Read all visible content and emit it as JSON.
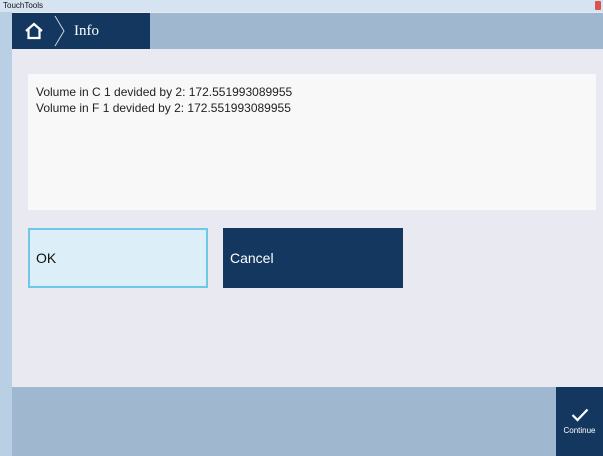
{
  "window": {
    "title": "TouchTools"
  },
  "header": {
    "breadcrumb": {
      "home_icon": "home-icon",
      "label": "Info"
    }
  },
  "message": {
    "lines": [
      "Volume in C 1 devided by 2: 172.551993089955",
      "Volume in F 1 devided by 2: 172.551993089955"
    ]
  },
  "buttons": {
    "ok_label": "OK",
    "cancel_label": "Cancel"
  },
  "footer": {
    "continue_label": "Continue",
    "continue_icon": "checkmark-icon"
  },
  "colors": {
    "accent_dark": "#13375f",
    "header_bar": "#9fb7cf",
    "ok_border": "#6ec7e6",
    "ok_background": "#dceef8",
    "content_background": "#e9e9f2"
  }
}
